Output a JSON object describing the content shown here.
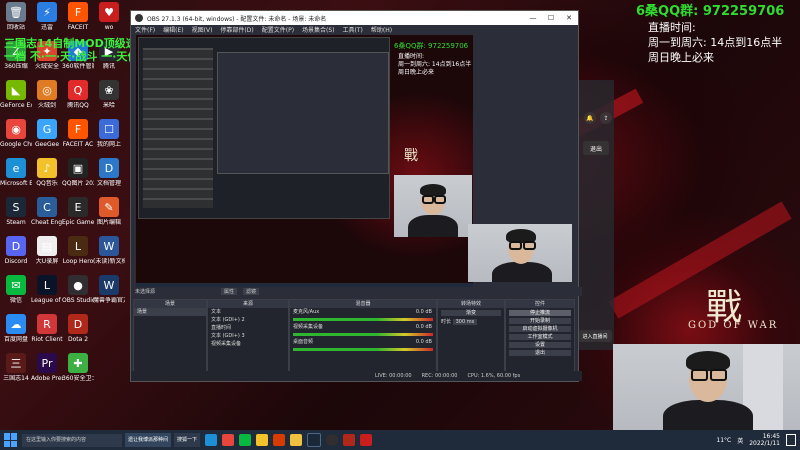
{
  "overlay": {
    "qq_group": "6桑QQ群: 972259706",
    "schedule_title": "直播时间:",
    "schedule_line1": "周一到周六: 14点到16点半",
    "schedule_line2": "周日晚上必来",
    "ticker_line1": "三国志14自制MOD顶级速推",
    "ticker_line2": "一档 不·一·天·战斗 一·天作战"
  },
  "wallpaper": {
    "big_char": "戰",
    "caption": "GOD OF WAR"
  },
  "desktop_icons": [
    {
      "label": "回收站",
      "color": "#6b7b8e",
      "glyph": "🗑"
    },
    {
      "label": "迅雷",
      "color": "#2a7de1",
      "glyph": "⚡"
    },
    {
      "label": "FACEIT",
      "color": "#ff5500",
      "glyph": "F"
    },
    {
      "label": "wo",
      "color": "#c81e1e",
      "glyph": "♥"
    },
    {
      "label": "360压缩",
      "color": "#2b9a3a",
      "glyph": "Z"
    },
    {
      "label": "火绒安全",
      "color": "#d8462b",
      "glyph": "✦"
    },
    {
      "label": "360软件管家",
      "color": "#1e7cd6",
      "glyph": "◆"
    },
    {
      "label": "腾讯",
      "color": "#26292e",
      "glyph": "▶"
    },
    {
      "label": "GeForce Experience",
      "color": "#76b900",
      "glyph": "◣"
    },
    {
      "label": "火绒剑",
      "color": "#e07b24",
      "glyph": "◎"
    },
    {
      "label": "腾讯QQ",
      "color": "#e12b2b",
      "glyph": "Q"
    },
    {
      "label": "米哈",
      "color": "#333",
      "glyph": "❀"
    },
    {
      "label": "Google Chrome",
      "color": "#e8453c",
      "glyph": "◉"
    },
    {
      "label": "GeeGee",
      "color": "#3aa5ff",
      "glyph": "G"
    },
    {
      "label": "FACEIT AC",
      "color": "#ff5500",
      "glyph": "F"
    },
    {
      "label": "我的网上",
      "color": "#3a6bd6",
      "glyph": "☐"
    },
    {
      "label": "Microsoft Edge",
      "color": "#1c8fd6",
      "glyph": "e"
    },
    {
      "label": "QQ音乐",
      "color": "#f3c22b",
      "glyph": "♪"
    },
    {
      "label": "QQ图片 20220107",
      "color": "#222",
      "glyph": "▣"
    },
    {
      "label": "文档管理",
      "color": "#2d77c8",
      "glyph": "D"
    },
    {
      "label": "Steam",
      "color": "#1b2838",
      "glyph": "S"
    },
    {
      "label": "Cheat Engine",
      "color": "#2a5e9a",
      "glyph": "C"
    },
    {
      "label": "Epic Games Launcher",
      "color": "#2a2a2a",
      "glyph": "E"
    },
    {
      "label": "图片编辑",
      "color": "#de5a2a",
      "glyph": "✎"
    },
    {
      "label": "Discord",
      "color": "#5865f2",
      "glyph": "D"
    },
    {
      "label": "大U录屏",
      "color": "#eeeeee",
      "glyph": "▤"
    },
    {
      "label": "Loop Hero",
      "color": "#4a2a10",
      "glyph": "L"
    },
    {
      "label": "(未读)新文档",
      "color": "#2b579a",
      "glyph": "W"
    },
    {
      "label": "微信",
      "color": "#09b83e",
      "glyph": "✉"
    },
    {
      "label": "League of Legends",
      "color": "#0a1428",
      "glyph": "L"
    },
    {
      "label": "OBS Studio",
      "color": "#302e31",
      "glyph": "●"
    },
    {
      "label": "魔兽争霸官方对战平台",
      "color": "#1a3a6a",
      "glyph": "W"
    },
    {
      "label": "百度网盘",
      "color": "#2a8bf2",
      "glyph": "☁"
    },
    {
      "label": "Riot Client",
      "color": "#d13639",
      "glyph": "R"
    },
    {
      "label": "Dota 2",
      "color": "#b0281a",
      "glyph": "D"
    },
    {
      "label": "",
      "color": "transparent",
      "glyph": ""
    },
    {
      "label": "三国志14",
      "color": "#5a1a1a",
      "glyph": "三"
    },
    {
      "label": "Adobe Premie...",
      "color": "#2a0a4a",
      "glyph": "Pr"
    },
    {
      "label": "360安全卫士",
      "color": "#3cb043",
      "glyph": "✚"
    },
    {
      "label": "",
      "color": "transparent",
      "glyph": ""
    }
  ],
  "obs": {
    "title": "OBS 27.1.3 (64-bit, windows) - 配置文件: 未命名 - 场景: 未命名",
    "menu": [
      "文件(F)",
      "编辑(E)",
      "视图(V)",
      "停靠部件(D)",
      "配置文件(P)",
      "场景集合(S)",
      "工具(T)",
      "帮助(H)"
    ],
    "no_source": "未选择源",
    "props_btn": "属性",
    "filters_btn": "滤镜",
    "docks": {
      "scenes_title": "场景",
      "scenes": [
        "场景"
      ],
      "sources_title": "来源",
      "sources": [
        "文本",
        "文本 (GDI+) 2",
        "直播时间",
        "文本 (GDI+) 3",
        "视频采集设备"
      ],
      "mixer_title": "混音器",
      "mixer": [
        {
          "name": "麦克风/Aux",
          "db": "0.0 dB"
        },
        {
          "name": "视频采集设备",
          "db": "0.0 dB"
        },
        {
          "name": "桌面音频",
          "db": "0.0 dB"
        }
      ],
      "transitions_title": "转场特效",
      "transition_value": "渐变",
      "duration_label": "时长",
      "duration_value": "300 ms",
      "controls_title": "控件",
      "controls": [
        "停止推流",
        "开始录制",
        "启动虚拟摄像机",
        "工作室模式",
        "设置",
        "退出"
      ]
    },
    "status": [
      "LIVE: 00:00:00",
      "REC: 00:00:00",
      "CPU: 1.6%, 60.00 fps"
    ]
  },
  "nested_overlay": {
    "qq": "6桑QQ群: 972259706",
    "line1": "直播时间:",
    "line2": "周一到周六: 14点到16点半",
    "line3": "周日晚上必来"
  },
  "side_panel": {
    "exit_label": "退出",
    "enter_label": "进入直播间"
  },
  "taskbar": {
    "search_placeholder": "在这里输入你要搜索的内容",
    "app1": "遗让我博派那种间",
    "app2": "搜狐一下",
    "weather": "11°C",
    "lang": "英",
    "time": "16:45",
    "date": "2022/1/11"
  },
  "colors": {
    "qq_green": "#2fdc2f",
    "ticker_green": "#3df03d",
    "obs_bg": "#2b2e38",
    "wall_red": "#7a0d14"
  }
}
